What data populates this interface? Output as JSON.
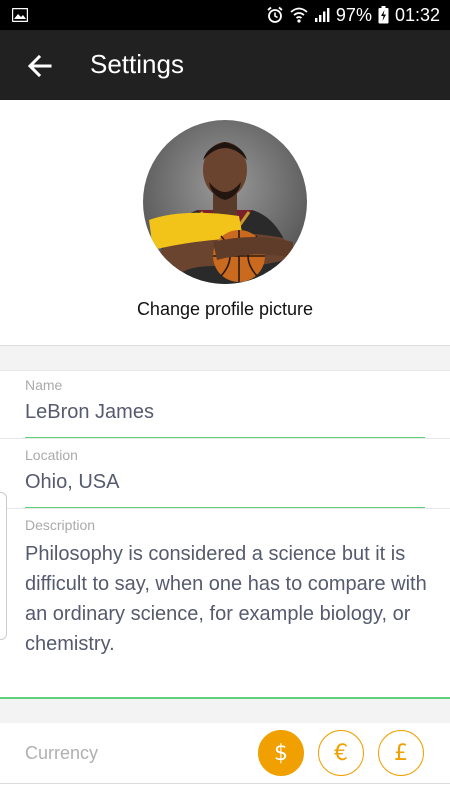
{
  "status_bar": {
    "battery": "97%",
    "time": "01:32"
  },
  "app_bar": {
    "title": "Settings"
  },
  "profile": {
    "change_picture_label": "Change profile picture"
  },
  "fields": {
    "name": {
      "label": "Name",
      "value": "LeBron James"
    },
    "location": {
      "label": "Location",
      "value": "Ohio, USA"
    },
    "description": {
      "label": "Description",
      "value": "Philosophy is considered a science but it is difficult to say, when one has to compare with an ordinary science, for example biology, or chemistry."
    }
  },
  "currency": {
    "label": "Currency",
    "options": [
      "$",
      "€",
      "£"
    ],
    "selected": "$"
  },
  "colors": {
    "accent": "#f0a000",
    "underline": "#5fd17a",
    "app_bar": "#212121"
  }
}
